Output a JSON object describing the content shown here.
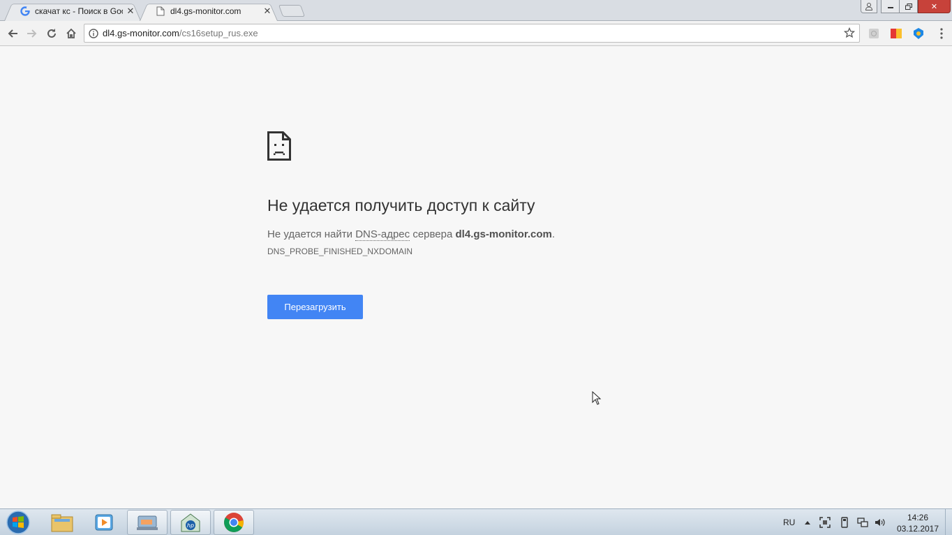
{
  "tabs": [
    {
      "title": "скачат кс - Поиск в Goo",
      "close": "✕",
      "favicon": "google-icon"
    },
    {
      "title": "dl4.gs-monitor.com",
      "close": "✕",
      "favicon": "page-icon"
    }
  ],
  "window_controls": {
    "user": "user-icon",
    "minimize": "minimize-icon",
    "maximize": "restore-icon",
    "close": "✕"
  },
  "omnibox": {
    "host": "dl4.gs-monitor.com",
    "path": "/cs16setup_rus.exe"
  },
  "error": {
    "headline": "Не удается получить доступ к сайту",
    "desc_before": "Не удается найти ",
    "desc_dns": "DNS-адрес",
    "desc_middle": " сервера ",
    "desc_host": "dl4.gs-monitor.com",
    "desc_after": ".",
    "code": "DNS_PROBE_FINISHED_NXDOMAIN",
    "reload_label": "Перезагрузить"
  },
  "taskbar": {
    "apps": [
      "windows-explorer-icon",
      "media-player-icon",
      "app-icon",
      "hp-icon",
      "chrome-icon"
    ],
    "language": "RU",
    "time": "14:26",
    "date": "03.12.2017"
  },
  "colors": {
    "accent": "#4285f4",
    "page_bg": "#f7f7f7",
    "close_red": "#c7423a"
  }
}
